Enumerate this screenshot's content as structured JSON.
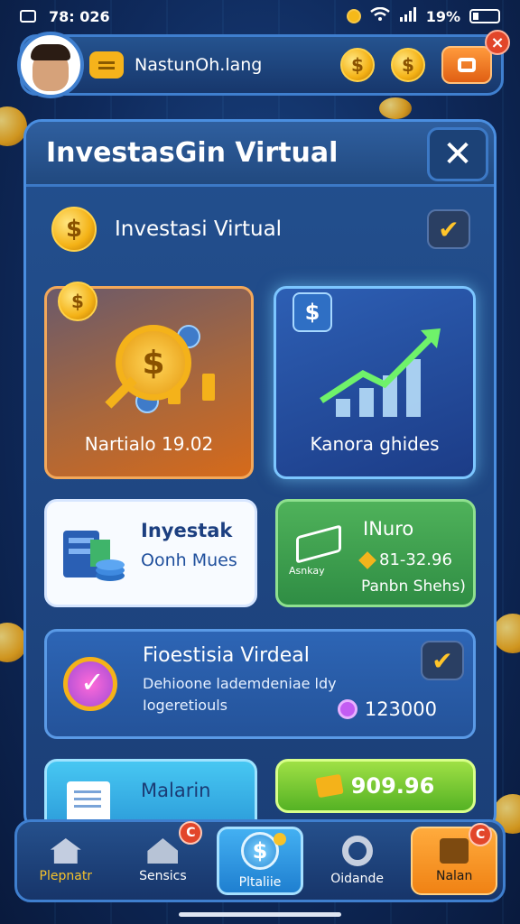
{
  "status_bar": {
    "time": "78: 026",
    "battery": "19%"
  },
  "header": {
    "player_name": "NastunOh.lang",
    "coin_symbol": "$",
    "badge": "×"
  },
  "panel": {
    "title": "InvestasGin Virtual",
    "close_label": "✕",
    "subheader": {
      "label": "Investasi Virtual",
      "coin_symbol": "$",
      "check": "✔"
    }
  },
  "cards": {
    "card_a": {
      "caption": "Nartialo 19.02",
      "coin_symbol": "$"
    },
    "card_b": {
      "caption": "Kanora ghides",
      "shield_symbol": "$"
    },
    "card_c": {
      "title": "Inyestak",
      "subtitle": "Oonh Mues"
    },
    "card_d": {
      "title": "INuro",
      "value": "81-32.96",
      "note": "Panbn Shehs)",
      "icon_label": "Asnkay"
    },
    "card_e": {
      "title": "Fioestisia Virdeal",
      "line1": "Dehioone lademdeniae ldy",
      "line2": "Iogeretiouls",
      "value": "123000",
      "check": "✔"
    },
    "card_f": {
      "title": "Malarin"
    },
    "card_g": {
      "value": "909.96"
    }
  },
  "bottom_nav": [
    {
      "label": "Plepnatr",
      "icon": "home-icon"
    },
    {
      "label": "Sensics",
      "icon": "house-icon",
      "badge": "C"
    },
    {
      "label": "Pltaliie",
      "icon": "dollar-icon"
    },
    {
      "label": "Oidande",
      "icon": "gear-icon"
    },
    {
      "label": "Nalan",
      "icon": "person-icon",
      "badge": "C"
    }
  ]
}
